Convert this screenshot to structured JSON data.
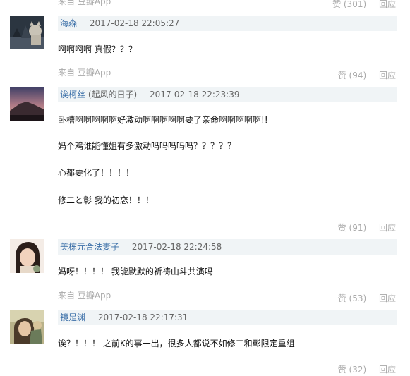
{
  "top_fragment": {
    "source": "来自 豆瓣App",
    "like_label": "赞 (301)",
    "reply_label": "回应"
  },
  "comments": [
    {
      "author": "海森",
      "author_note": "",
      "time": "2017-02-18 22:05:27",
      "lines": [
        "啊啊啊啊 真假？？？"
      ],
      "source": "来自 豆瓣App",
      "like_label": "赞 (94)",
      "reply_label": "回应"
    },
    {
      "author": "诶柯丝",
      "author_note": "(起风的日子)",
      "time": "2017-02-18 22:23:39",
      "lines": [
        "卧槽啊啊啊啊啊好激动啊啊啊啊啊要了亲命啊啊啊啊啊!!",
        "妈个鸡谁能懂姐有多激动吗吗吗吗吗？？？？？",
        "心都要化了！！！！",
        "修二と彰 我的初恋！！！"
      ],
      "source": "",
      "like_label": "赞 (91)",
      "reply_label": "回应"
    },
    {
      "author": "美栋元合法妻子",
      "author_note": "",
      "time": "2017-02-18 22:24:58",
      "lines": [
        "妈呀！！！！ 我能默默的祈祷山斗共演吗"
      ],
      "source": "来自 豆瓣App",
      "like_label": "赞 (53)",
      "reply_label": "回应"
    },
    {
      "author": "镜是渊",
      "author_note": "",
      "time": "2017-02-18 22:17:31",
      "lines": [
        "诶？！！！ 之前K的事一出，很多人都说不如修二和彰限定重组"
      ],
      "source": "",
      "like_label": "赞 (32)",
      "reply_label": "回应"
    }
  ],
  "colors": {
    "author_link": "#3b6fa8",
    "muted": "#a9a9a9",
    "header_bg": "#f0f4f6"
  }
}
